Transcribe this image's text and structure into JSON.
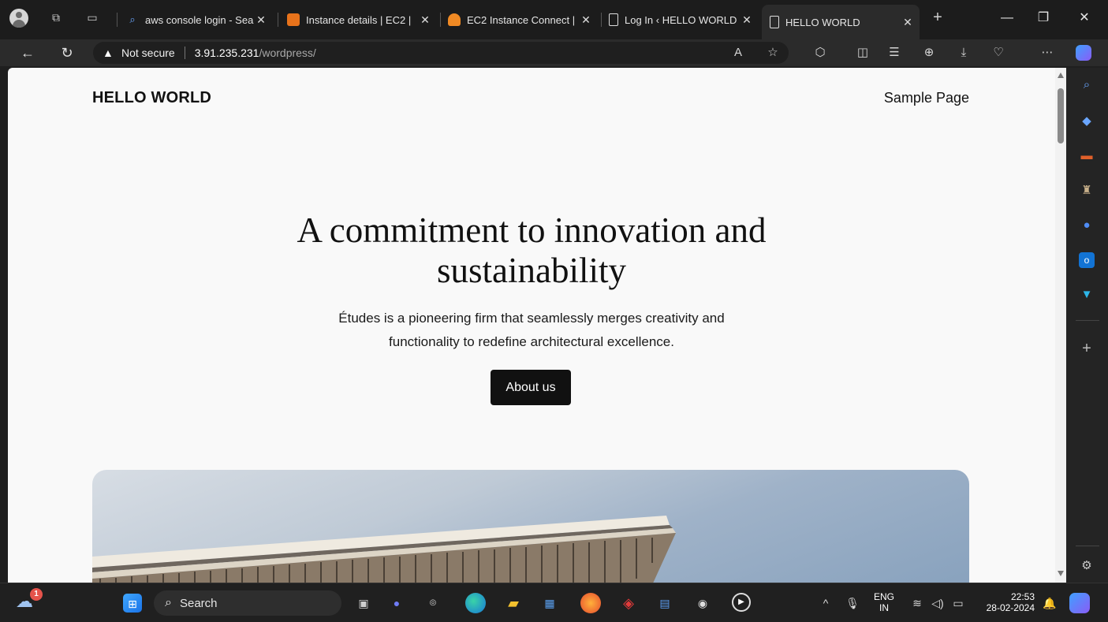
{
  "browser": {
    "tabs": [
      {
        "title": "aws console login - Sea",
        "active": false
      },
      {
        "title": "Instance details | EC2 |",
        "active": false
      },
      {
        "title": "EC2 Instance Connect |",
        "active": false
      },
      {
        "title": "Log In ‹ HELLO WORLD",
        "active": false
      },
      {
        "title": "HELLO WORLD",
        "active": true
      }
    ],
    "new_tab": "+",
    "address": {
      "security": "Not secure",
      "host": "3.91.235.231",
      "path": "/wordpress/"
    }
  },
  "site": {
    "title": "HELLO WORLD",
    "nav": "Sample Page",
    "hero": {
      "heading_line1": "A commitment to innovation and",
      "heading_line2": "sustainability",
      "text_line1": "Études is a pioneering firm that seamlessly merges creativity and",
      "text_line2": "functionality to redefine architectural excellence.",
      "button": "About us"
    }
  },
  "taskbar": {
    "notification_count": "1",
    "search_label": "Search",
    "language_line1": "ENG",
    "language_line2": "IN",
    "time": "22:53",
    "date": "28-02-2024"
  },
  "colors": {
    "page_bg": "#f9f9f9",
    "button_bg": "#111111",
    "chrome_dark": "#1c1c1c"
  }
}
